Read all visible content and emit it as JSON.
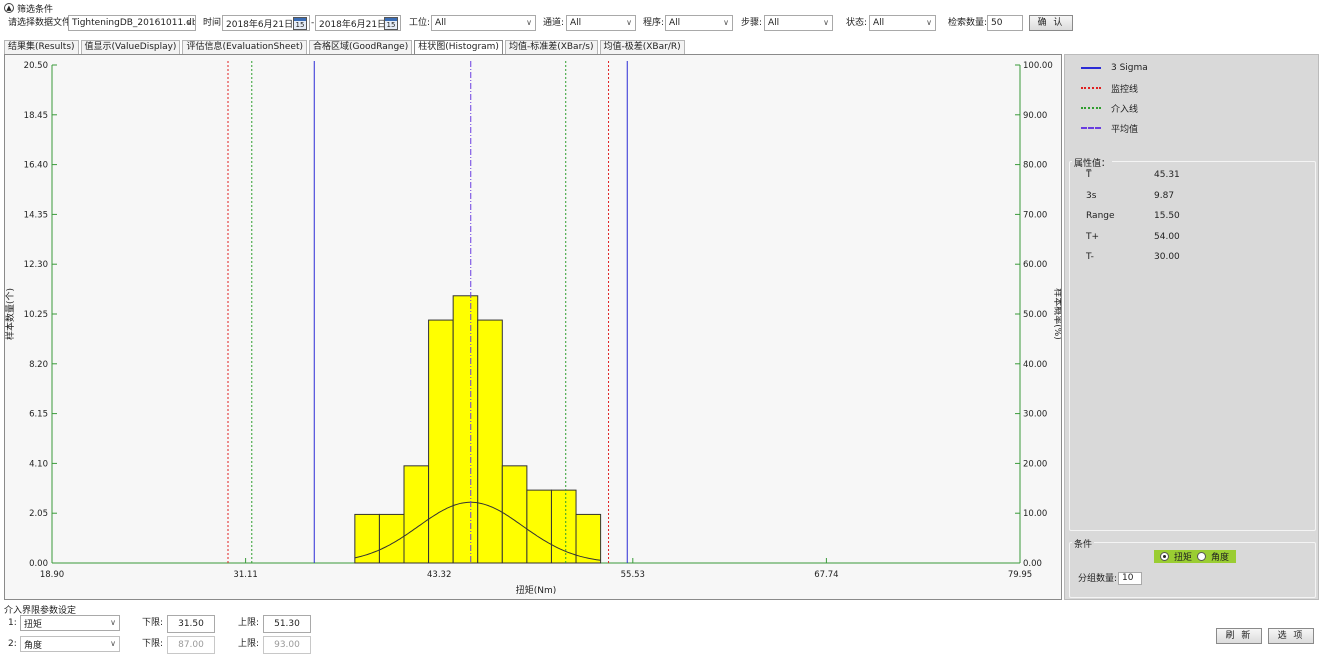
{
  "filter": {
    "section_title": "筛选条件",
    "collapse_icon": "▲",
    "file_label": "请选择数据文件:",
    "file_value": "TighteningDB_20161011.db",
    "time_label": "时间:",
    "date_from": "2018年6月21日",
    "date_sep": "-",
    "date_to": "2018年6月21日",
    "calendar_day": "15",
    "station_label": "工位:",
    "station_value": "All",
    "channel_label": "通道:",
    "channel_value": "All",
    "program_label": "程序:",
    "program_value": "All",
    "step_label": "步骤:",
    "step_value": "All",
    "status_label": "状态:",
    "status_value": "All",
    "count_label": "检索数量:",
    "count_value": "50",
    "confirm_label": "确 认",
    "chevron": "∨"
  },
  "tabs": [
    {
      "label": "结果集(Results)",
      "active": false
    },
    {
      "label": "值显示(ValueDisplay)",
      "active": false
    },
    {
      "label": "评估信息(EvaluationSheet)",
      "active": false
    },
    {
      "label": "合格区域(GoodRange)",
      "active": false
    },
    {
      "label": "柱状图(Histogram)",
      "active": true
    },
    {
      "label": "均值-标准差(XBar/s)",
      "active": false
    },
    {
      "label": "均值-极差(XBar/R)",
      "active": false
    }
  ],
  "chart_data": {
    "type": "bar",
    "xlabel": "扭矩(Nm)",
    "ylabel": "样本数量(个)",
    "y2label": "样本概率(%)",
    "xlim": [
      18.9,
      79.95
    ],
    "ylim": [
      0,
      20.5
    ],
    "y2lim": [
      0,
      100
    ],
    "x_ticks": [
      18.9,
      31.11,
      43.32,
      55.53,
      67.74,
      79.95
    ],
    "x_tick_labels": [
      "18.90",
      "31.11",
      "43.32",
      "55.53",
      "67.74",
      "79.95"
    ],
    "y_ticks": [
      0,
      2.05,
      4.1,
      6.15,
      8.2,
      10.25,
      12.3,
      14.35,
      16.4,
      18.45,
      20.5
    ],
    "y_tick_labels": [
      "0.00",
      "2.05",
      "4.10",
      "6.15",
      "8.20",
      "10.25",
      "12.30",
      "14.35",
      "16.40",
      "18.45",
      "20.50"
    ],
    "y2_ticks": [
      0,
      10,
      20,
      30,
      40,
      50,
      60,
      70,
      80,
      90,
      100
    ],
    "y2_tick_labels": [
      "0.00",
      "10.00",
      "20.00",
      "30.00",
      "40.00",
      "50.00",
      "60.00",
      "70.00",
      "80.00",
      "90.00",
      "100.00"
    ],
    "bin_edges": [
      38.0,
      39.55,
      41.1,
      42.65,
      44.2,
      45.75,
      47.3,
      48.85,
      50.4,
      51.95,
      53.5
    ],
    "counts": [
      2,
      2,
      4,
      10,
      11,
      10,
      4,
      3,
      3,
      2
    ],
    "bar_color": "#ffff00",
    "normal_curve": {
      "mean": 45.31,
      "sigma": 3.29,
      "peak_count": 2.5
    },
    "lines": [
      {
        "name": "3 Sigma",
        "x": 35.44,
        "color": "#2b2bd6",
        "style": "solid"
      },
      {
        "name": "3 Sigma",
        "x": 55.18,
        "color": "#2b2bd6",
        "style": "solid"
      },
      {
        "name": "监控线",
        "x": 30.0,
        "color": "#e02020",
        "style": "dotted"
      },
      {
        "name": "监控线",
        "x": 54.0,
        "color": "#e02020",
        "style": "dotted"
      },
      {
        "name": "介入线",
        "x": 31.5,
        "color": "#2e9e2e",
        "style": "dotted"
      },
      {
        "name": "介入线",
        "x": 51.3,
        "color": "#2e9e2e",
        "style": "dotted"
      },
      {
        "name": "平均值",
        "x": 45.31,
        "color": "#6a3de0",
        "style": "dashdot"
      }
    ],
    "grid": false
  },
  "legend": [
    {
      "label": "3 Sigma",
      "color": "#2b2bd6",
      "style": "solid"
    },
    {
      "label": "监控线",
      "color": "#e02020",
      "style": "dotted"
    },
    {
      "label": "介入线",
      "color": "#2e9e2e",
      "style": "dotted"
    },
    {
      "label": "平均值",
      "color": "#6a3de0",
      "style": "dashdot"
    }
  ],
  "properties": {
    "title": "属性值：",
    "rows": [
      {
        "key": "T̅",
        "value": "45.31"
      },
      {
        "key": "3s",
        "value": "9.87"
      },
      {
        "key": "Range",
        "value": "15.50"
      },
      {
        "key": "T+",
        "value": "54.00"
      },
      {
        "key": "T-",
        "value": "30.00"
      }
    ]
  },
  "conditions": {
    "title": "条件",
    "radio_torque": "扭矩",
    "radio_angle": "角度",
    "selected": "torque",
    "group_count_label": "分组数量:",
    "group_count_value": "10"
  },
  "limits": {
    "title": "介入界限参数设定",
    "row1_num": "1:",
    "row1_type": "扭矩",
    "row1_lower_label": "下限:",
    "row1_lower_value": "31.50",
    "row1_upper_label": "上限:",
    "row1_upper_value": "51.30",
    "row2_num": "2:",
    "row2_type": "角度",
    "row2_lower_label": "下限:",
    "row2_lower_value": "87.00",
    "row2_upper_label": "上限:",
    "row2_upper_value": "93.00"
  },
  "footer": {
    "refresh_label": "刷 新",
    "options_label": "选 项"
  }
}
